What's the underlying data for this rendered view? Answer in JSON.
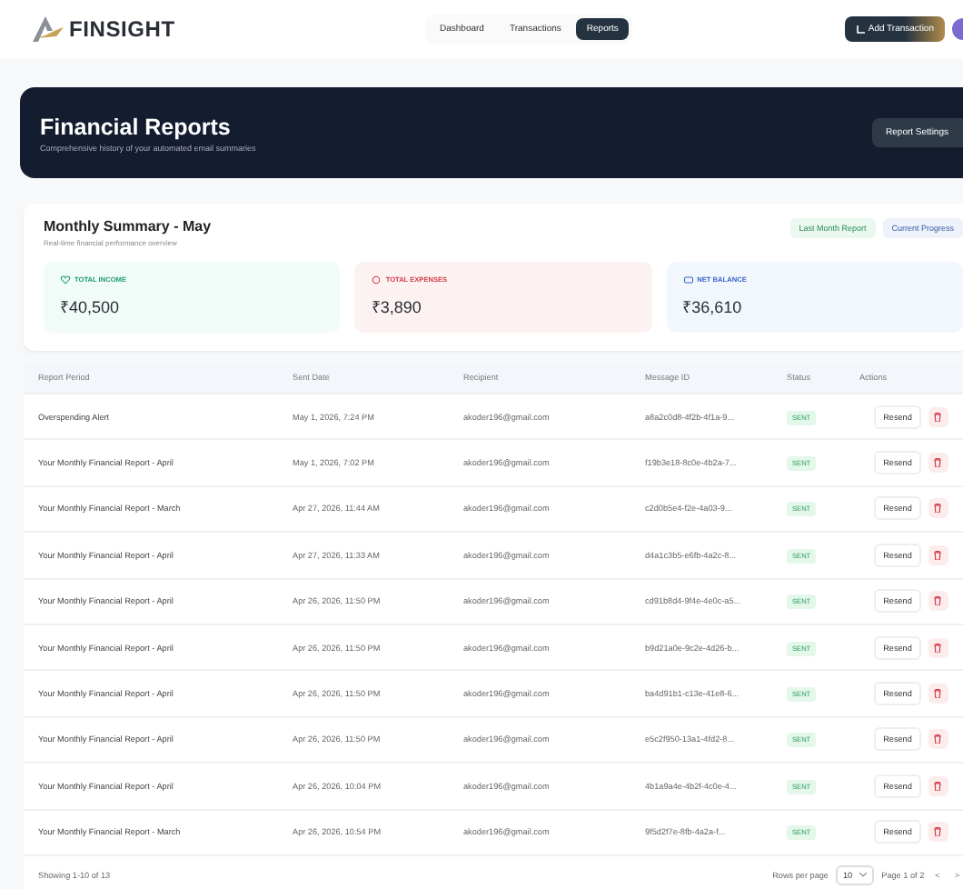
{
  "brand": {
    "name": "FINSIGHT"
  },
  "nav": {
    "tabs": [
      {
        "label": "Dashboard",
        "selected": false
      },
      {
        "label": "Transactions",
        "selected": false
      },
      {
        "label": "Reports",
        "selected": true
      }
    ],
    "add_button": "Add Transaction"
  },
  "banner": {
    "title": "Financial Reports",
    "subtitle": "Comprehensive history of your automated email summaries",
    "button": "Report Settings"
  },
  "summary": {
    "title": "Monthly Summary - May",
    "subtitle": "Real-time financial performance overview",
    "buttons": [
      "Last Month Report",
      "Current Progress"
    ],
    "stats": [
      {
        "kind": "income",
        "label": "TOTAL INCOME",
        "value": "₹40,500"
      },
      {
        "kind": "expense",
        "label": "TOTAL EXPENSES",
        "value": "₹3,890"
      },
      {
        "kind": "balance",
        "label": "NET BALANCE",
        "value": "₹36,610"
      }
    ]
  },
  "table": {
    "columns": [
      "Report Period",
      "Sent Date",
      "Recipient",
      "Message ID",
      "Status",
      "Actions"
    ],
    "rows": [
      {
        "period": "Overspending Alert",
        "date": "May 1, 2026, 7:24 PM",
        "recipient": "akoder196@gmail.com",
        "message_id": "a8a2c0d8-4f2b-4f1a-9...",
        "status": "SENT",
        "action": "Resend"
      },
      {
        "period": "Your Monthly Financial Report - April",
        "date": "May 1, 2026, 7:02 PM",
        "recipient": "akoder196@gmail.com",
        "message_id": "f19b3e18-8c0e-4b2a-7...",
        "status": "SENT",
        "action": "Resend"
      },
      {
        "period": "Your Monthly Financial Report - March",
        "date": "Apr 27, 2026, 11:44 AM",
        "recipient": "akoder196@gmail.com",
        "message_id": "c2d0b5e4-f2e-4a03-9...",
        "status": "SENT",
        "action": "Resend"
      },
      {
        "period": "Your Monthly Financial Report - April",
        "date": "Apr 27, 2026, 11:33 AM",
        "recipient": "akoder196@gmail.com",
        "message_id": "d4a1c3b5-e6fb-4a2c-8...",
        "status": "SENT",
        "action": "Resend"
      },
      {
        "period": "Your Monthly Financial Report - April",
        "date": "Apr 26, 2026, 11:50 PM",
        "recipient": "akoder196@gmail.com",
        "message_id": "cd91b8d4-9f4e-4e0c-a5...",
        "status": "SENT",
        "action": "Resend"
      },
      {
        "period": "Your Monthly Financial Report - April",
        "date": "Apr 26, 2026, 11:50 PM",
        "recipient": "akoder196@gmail.com",
        "message_id": "b9d21a0e-9c2e-4d26-b...",
        "status": "SENT",
        "action": "Resend"
      },
      {
        "period": "Your Monthly Financial Report - April",
        "date": "Apr 26, 2026, 11:50 PM",
        "recipient": "akoder196@gmail.com",
        "message_id": "ba4d91b1-c13e-41e8-6...",
        "status": "SENT",
        "action": "Resend"
      },
      {
        "period": "Your Monthly Financial Report - April",
        "date": "Apr 26, 2026, 11:50 PM",
        "recipient": "akoder196@gmail.com",
        "message_id": "e5c2f950-13a1-4fd2-8...",
        "status": "SENT",
        "action": "Resend"
      },
      {
        "period": "Your Monthly Financial Report - April",
        "date": "Apr 26, 2026, 10:04 PM",
        "recipient": "akoder196@gmail.com",
        "message_id": "4b1a9a4e-4b2f-4c0e-4...",
        "status": "SENT",
        "action": "Resend"
      },
      {
        "period": "Your Monthly Financial Report - March",
        "date": "Apr 26, 2026, 10:54 PM",
        "recipient": "akoder196@gmail.com",
        "message_id": "9f5d2f7e-8fb-4a2a-f...",
        "status": "SENT",
        "action": "Resend"
      }
    ],
    "footer": {
      "showing": "Showing 1-10 of 13",
      "rows_label": "Rows per page",
      "rows_value": "10",
      "page": "Page 1 of 2",
      "prev": "<",
      "next": ">"
    }
  }
}
